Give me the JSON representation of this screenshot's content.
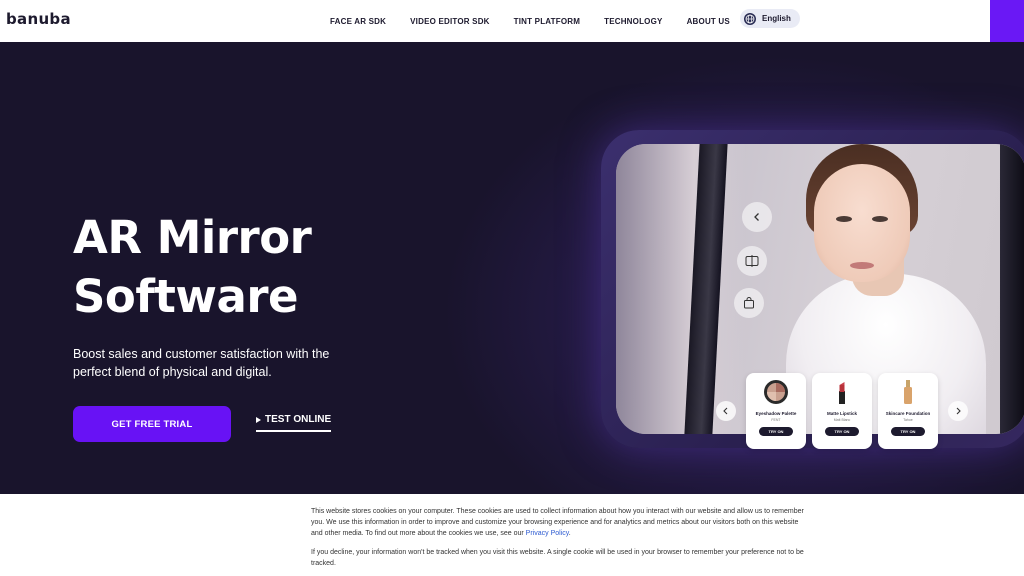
{
  "header": {
    "logo": "banuba",
    "nav": [
      "FACE AR SDK",
      "VIDEO EDITOR SDK",
      "TINT PLATFORM",
      "TECHNOLOGY",
      "ABOUT US"
    ],
    "language": "English"
  },
  "hero": {
    "title_line1": "AR Mirror",
    "title_line2": "Software",
    "subtitle": "Boost sales and customer satisfaction with the perfect blend of physical and digital.",
    "cta_primary": "GET FREE TRIAL",
    "cta_secondary": "TEST ONLINE"
  },
  "mirror": {
    "products": [
      {
        "name": "Eyeshadow Palette",
        "shade": "FENT",
        "action": "TRY ON"
      },
      {
        "name": "Matte Lipstick",
        "shade": "Matt Blanc",
        "action": "TRY ON"
      },
      {
        "name": "Skincare Foundation",
        "shade": "Tahoe",
        "action": "TRY ON"
      }
    ]
  },
  "cookie_banner": {
    "text1": "This website stores cookies on your computer. These cookies are used to collect information about how you interact with our website and allow us to remember you. We use this information in order to improve and customize your browsing experience and for analytics and metrics about our visitors both on this website and other media. To find out more about the cookies we use, see our ",
    "policy_link": "Privacy Policy",
    "text1_end": ".",
    "text2": "If you decline, your information won't be tracked when you visit this website. A single cookie will be used in your browser to remember your preference not to be tracked."
  },
  "colors": {
    "accent": "#6812f5",
    "hero_bg": "#19142c",
    "link": "#2d5bd1"
  }
}
